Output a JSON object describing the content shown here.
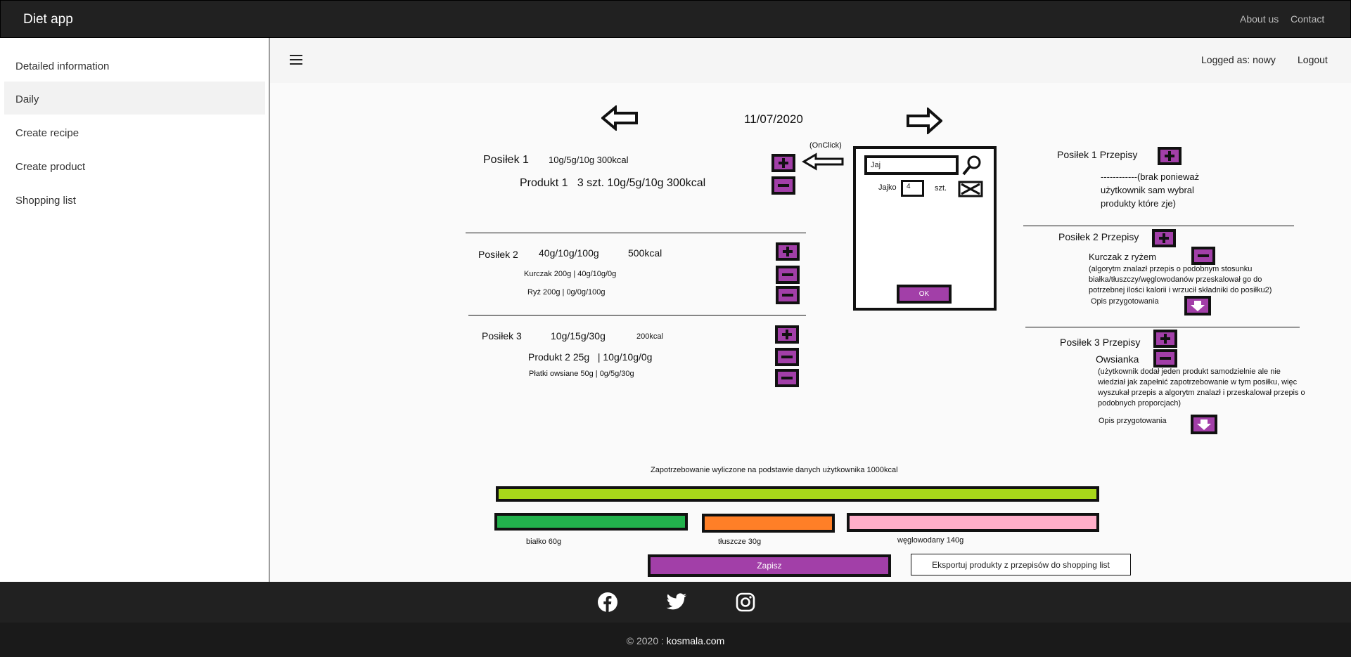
{
  "header": {
    "brand": "Diet app",
    "about": "About us",
    "contact": "Contact"
  },
  "sidebar": {
    "items": [
      {
        "label": "Detailed information"
      },
      {
        "label": "Daily"
      },
      {
        "label": "Create recipe"
      },
      {
        "label": "Create product"
      },
      {
        "label": "Shopping list"
      }
    ]
  },
  "subbar": {
    "logged_as": "Logged as: nowy",
    "logout": "Logout"
  },
  "main": {
    "date": "11/07/2020",
    "onclick_note": "(OnClick)",
    "meals": [
      {
        "title": "Posiłek 1",
        "macros": "10g/5g/10g 300kcal",
        "kcal": "",
        "items": [
          "Produkt 1   3 szt. 10g/5g/10g 300kcal"
        ]
      },
      {
        "title": "Posiłek 2",
        "macros": "40g/10g/100g",
        "kcal": "500kcal",
        "items": [
          "Kurczak 200g | 40g/10g/0g",
          "Ryż 200g | 0g/0g/100g"
        ]
      },
      {
        "title": "Posiłek 3",
        "macros": "10g/15g/30g",
        "kcal": "200kcal",
        "items": [
          "Produkt 2 25g   | 10g/10g/0g",
          "Płatki owsiane 50g | 0g/5g/30g"
        ]
      }
    ],
    "popup": {
      "search_value": "Jaj",
      "product": "Jajko",
      "qty": "4",
      "unit": "szt.",
      "ok": "OK"
    },
    "recipes": [
      {
        "title": "Posiłek 1 Przepisy",
        "name": "",
        "note": [
          "------------(brak ponieważ",
          "użytkownik sam wybral",
          "produkty które zje)"
        ],
        "opis": ""
      },
      {
        "title": "Posiłek 2 Przepisy",
        "name": "Kurczak z ryżem",
        "note": [
          "(algorytm znalazł przepis o podobnym stosunku",
          "białka/tłuszczy/węglowodanów przeskalował go do",
          "potrzebnej ilości kalorii i wrzucił składniki do posiłku2)"
        ],
        "opis": "Opis przygotowania"
      },
      {
        "title": "Posiłek 3 Przepisy",
        "name": "Owsianka",
        "note": [
          "(użytkownik dodał jeden produkt samodzielnie ale nie",
          "wiedział jak zapełnić zapotrzebowanie w tym posiłku, więc",
          "wyszukał przepis a algorytm znalazł i przeskalował przepis o",
          "podobnych proporcjach)"
        ],
        "opis": "Opis przygotowania"
      }
    ],
    "summary": {
      "label": "Zapotrzebowanie wyliczone na podstawie danych użytkownika 1000kcal",
      "protein": "białko 60g",
      "fat": "tłuszcze 30g",
      "carbs": "węglowodany 140g",
      "save": "Zapisz",
      "export": "Eksportuj produkty z przepisów do shopping list",
      "colors": {
        "total": "#a8d81a",
        "protein": "#22b14c",
        "fat": "#ff7f27",
        "carbs": "#ffaec9",
        "button": "#a23fa8"
      }
    }
  },
  "footer": {
    "icons": [
      "facebook-icon",
      "twitter-icon",
      "instagram-icon"
    ],
    "copy_prefix": "© 2020 : ",
    "copy_site": "kosmala.com"
  }
}
